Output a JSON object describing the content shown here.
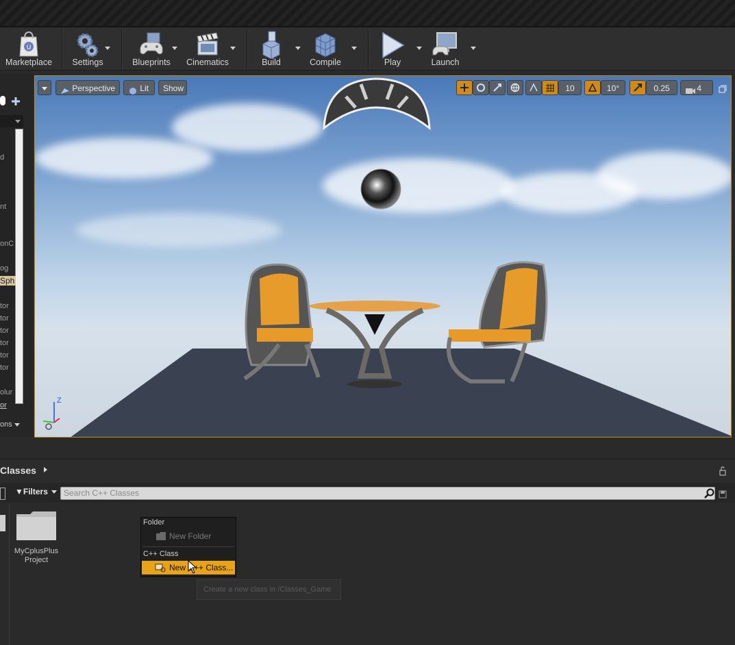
{
  "toolbar": {
    "items": [
      {
        "label": "Marketplace",
        "icon": "marketplace-bag-icon"
      },
      {
        "label": "Settings",
        "icon": "gears-icon"
      },
      {
        "label": "Blueprints",
        "icon": "gamepad-icon"
      },
      {
        "label": "Cinematics",
        "icon": "clapperboard-icon"
      },
      {
        "label": "Build",
        "icon": "build-cubes-icon"
      },
      {
        "label": "Compile",
        "icon": "compile-cubes-icon"
      },
      {
        "label": "Play",
        "icon": "play-icon"
      },
      {
        "label": "Launch",
        "icon": "launch-monitor-icon"
      }
    ]
  },
  "left_panel": {
    "fragments": [
      "d",
      "nt",
      "onC",
      "og",
      "Sph",
      "tor",
      "tor",
      "tor",
      "tor",
      "tor",
      "tor",
      "olur",
      "or",
      "ons"
    ]
  },
  "viewport": {
    "view_mode": "Perspective",
    "lit": "Lit",
    "show": "Show",
    "grid_snap": "10",
    "rotation_snap": "10°",
    "scale_snap": "0.25",
    "camera_speed": "4",
    "axis_z": "Z"
  },
  "content_browser": {
    "title": "Classes",
    "filters": "Filters",
    "search_placeholder": "Search C++ Classes",
    "folder_label_line1": "MyCplusPlus",
    "folder_label_line2": "Project"
  },
  "context_menu": {
    "folder_header": "Folder",
    "new_folder": "New Folder",
    "class_header": "C++ Class",
    "new_class": "New C++ Class...",
    "tooltip": "Create a new class in /Classes_Game"
  },
  "colors": {
    "accent": "#e8a319",
    "viewport_border": "#c98a12"
  }
}
